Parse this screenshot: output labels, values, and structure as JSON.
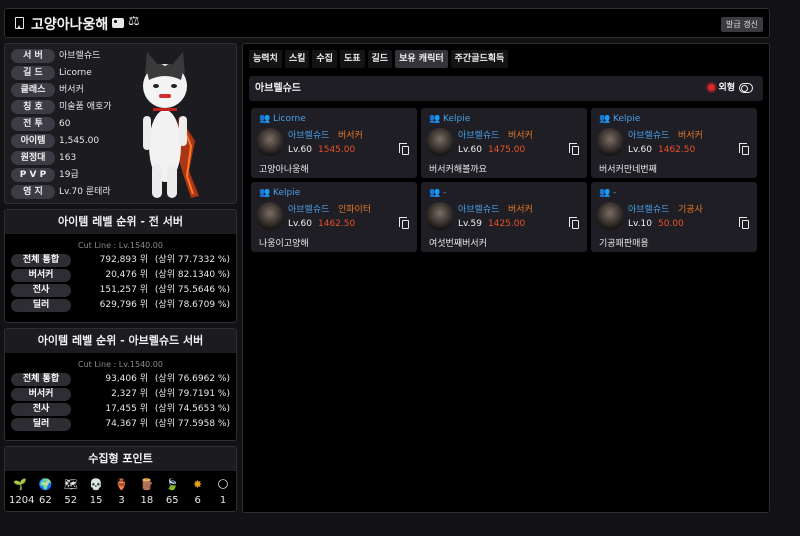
{
  "header": {
    "name": "고양아나웅해",
    "renew_label": "발급 갱신"
  },
  "profile": {
    "rows": [
      {
        "label": "서 버",
        "value": "아브렐슈드"
      },
      {
        "label": "길 드",
        "value": "Licorne"
      },
      {
        "label": "클래스",
        "value": "버서커"
      },
      {
        "label": "칭 호",
        "value": "미술품 애호가"
      },
      {
        "label": "전 투",
        "value": "60"
      },
      {
        "label": "아이템",
        "value": "1,545.00"
      },
      {
        "label": "원정대",
        "value": "163"
      },
      {
        "label": "P V P",
        "value": "19급"
      },
      {
        "label": "영 지",
        "value": "Lv.70 룬테라"
      }
    ]
  },
  "rank_all": {
    "title": "아이템 레벨 순위 - 전 서버",
    "cutline": "Cut Line : Lv.1540.00",
    "rows": [
      {
        "label": "전체 통합",
        "rank": "792,893 위",
        "pct": "(상위 77.7332 %)"
      },
      {
        "label": "버서커",
        "rank": "20,476 위",
        "pct": "(상위 82.1340 %)"
      },
      {
        "label": "전사",
        "rank": "151,257 위",
        "pct": "(상위 75.5646 %)"
      },
      {
        "label": "딜러",
        "rank": "629,796 위",
        "pct": "(상위 78.6709 %)"
      }
    ]
  },
  "rank_server": {
    "title": "아이템 레벨 순위 - 아브렐슈드 서버",
    "cutline": "Cut Line : Lv.1540.00",
    "rows": [
      {
        "label": "전체 통합",
        "rank": "93,406 위",
        "pct": "(상위 76.6962 %)"
      },
      {
        "label": "버서커",
        "rank": "2,327 위",
        "pct": "(상위 79.7191 %)"
      },
      {
        "label": "전사",
        "rank": "17,455 위",
        "pct": "(상위 74.5653 %)"
      },
      {
        "label": "딜러",
        "rank": "74,367 위",
        "pct": "(상위 77.5958 %)"
      }
    ]
  },
  "collection": {
    "title": "수집형 포인트",
    "items": [
      {
        "icon": "seed-icon",
        "glyph": "🌱",
        "value": "1204"
      },
      {
        "icon": "island-heart-icon",
        "glyph": "🌍",
        "value": "62"
      },
      {
        "icon": "art-map-icon",
        "glyph": "🗺",
        "value": "52"
      },
      {
        "icon": "giant-heart-icon",
        "glyph": "💀",
        "value": "15"
      },
      {
        "icon": "ignea-token-icon",
        "glyph": "🏺",
        "value": "3"
      },
      {
        "icon": "orpheus-star-icon",
        "glyph": "🪵",
        "value": "18"
      },
      {
        "icon": "world-tree-leaf-icon",
        "glyph": "🍃",
        "value": "65"
      },
      {
        "icon": "sea-bounty-icon",
        "glyph": "✸",
        "value": "6"
      },
      {
        "icon": "omnium-seed-icon",
        "glyph": "🌕",
        "value": "1"
      }
    ]
  },
  "tabs": [
    {
      "label": "능력치",
      "active": false
    },
    {
      "label": "스킬",
      "active": false
    },
    {
      "label": "수집",
      "active": false
    },
    {
      "label": "도표",
      "active": false
    },
    {
      "label": "길드",
      "active": false
    },
    {
      "label": "보유 캐릭터",
      "active": true
    },
    {
      "label": "주간골드획득",
      "active": false
    }
  ],
  "characters_section": {
    "title": "아브렐슈드",
    "outfit_label": "외형"
  },
  "characters": [
    {
      "guild": "Licorne",
      "server": "아브렐슈드",
      "class": "버서커",
      "level": "Lv.60",
      "ilvl": "1545.00",
      "name": "고양아나웅해"
    },
    {
      "guild": "Kelpie",
      "server": "아브렐슈드",
      "class": "버서커",
      "level": "Lv.60",
      "ilvl": "1475.00",
      "name": "버서커해볼까요"
    },
    {
      "guild": "Kelpie",
      "server": "아브렐슈드",
      "class": "버서커",
      "level": "Lv.60",
      "ilvl": "1462.50",
      "name": "버서커만네번째"
    },
    {
      "guild": "Kelpie",
      "server": "아브렐슈드",
      "class": "인파이터",
      "level": "Lv.60",
      "ilvl": "1462.50",
      "name": "나웅이고양해"
    },
    {
      "guild": "-",
      "server": "아브렐슈드",
      "class": "버서커",
      "level": "Lv.59",
      "ilvl": "1425.00",
      "name": "여섯번째버서커"
    },
    {
      "guild": "-",
      "server": "아브렐슈드",
      "class": "기공사",
      "level": "Lv.10",
      "ilvl": "50.00",
      "name": "기공패판매용"
    }
  ]
}
